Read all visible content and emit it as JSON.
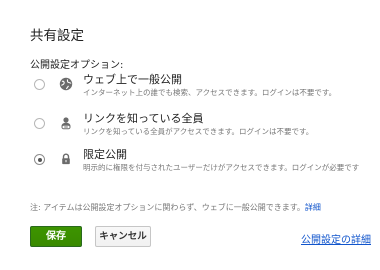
{
  "dialog": {
    "title": "共有設定",
    "section_label": "公開設定オプション:"
  },
  "options": [
    {
      "title": "ウェブ上で一般公開",
      "description": "インターネット上の誰でも検索、アクセスできます。ログインは不要です。",
      "icon": "globe-icon",
      "selected": false
    },
    {
      "title": "リンクを知っている全員",
      "description": "リンクを知っている全員がアクセスできます。ログインは不要です。",
      "icon": "link-person-icon",
      "selected": false
    },
    {
      "title": "限定公開",
      "description": "明示的に権限を付与されたユーザーだけがアクセスできます。ログインが必要です",
      "icon": "lock-icon",
      "selected": true
    }
  ],
  "note": {
    "text": "注: アイテムは公開設定オプションに関わらず、ウェブに一般公開できます。",
    "link": "詳細"
  },
  "buttons": {
    "save": "保存",
    "cancel": "キャンセル"
  },
  "links": {
    "details": "公開設定の詳細"
  },
  "colors": {
    "save_button": "#3d9400",
    "link": "#1155cc"
  }
}
